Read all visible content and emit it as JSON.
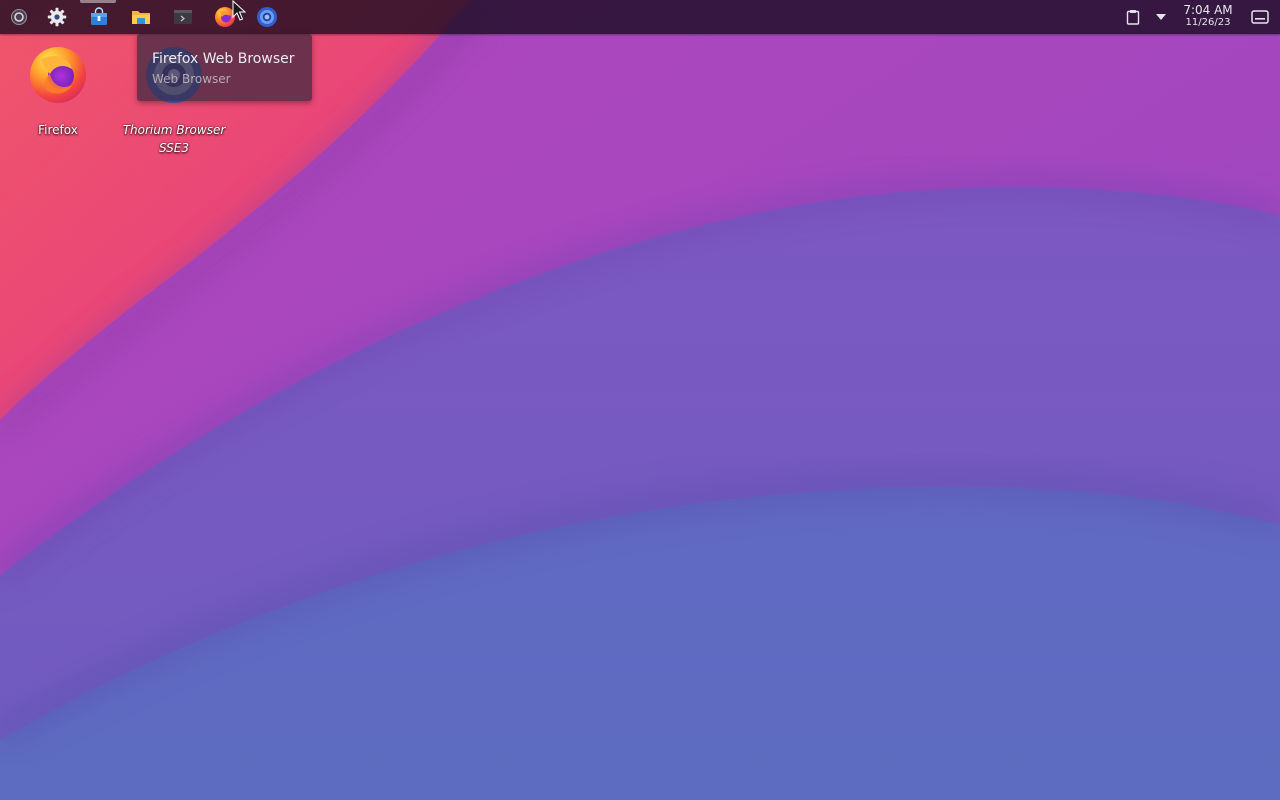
{
  "panel": {
    "launchers": [
      {
        "name": "application-menu",
        "icon": "app-menu-icon"
      },
      {
        "name": "system-settings",
        "icon": "gear-icon"
      },
      {
        "name": "software-store",
        "icon": "store-bag-icon"
      },
      {
        "name": "file-manager",
        "icon": "folder-icon"
      },
      {
        "name": "terminal",
        "icon": "terminal-icon"
      },
      {
        "name": "firefox",
        "icon": "firefox-icon"
      },
      {
        "name": "thorium-browser",
        "icon": "thorium-icon"
      }
    ],
    "tray": {
      "clipboard_icon": "clipboard-icon",
      "expand_icon": "caret-down-icon",
      "show_desktop_icon": "show-desktop-icon"
    },
    "clock": {
      "time": "7:04 AM",
      "date": "11/26/23"
    }
  },
  "desktop": {
    "icons": [
      {
        "label": "Firefox",
        "icon": "firefox-icon"
      },
      {
        "label_line1": "Thorium Browser",
        "label_line2": "SSE3",
        "icon": "thorium-icon"
      }
    ]
  },
  "tooltip": {
    "title": "Firefox Web Browser",
    "subtitle": "Web Browser"
  },
  "colors": {
    "wallpaper_base": "#5f6cc0",
    "wallpaper_violet": "#7a58c0",
    "wallpaper_magenta": "#a444bf",
    "wallpaper_pink": "#e8437a",
    "panel": "#1e0f26"
  }
}
